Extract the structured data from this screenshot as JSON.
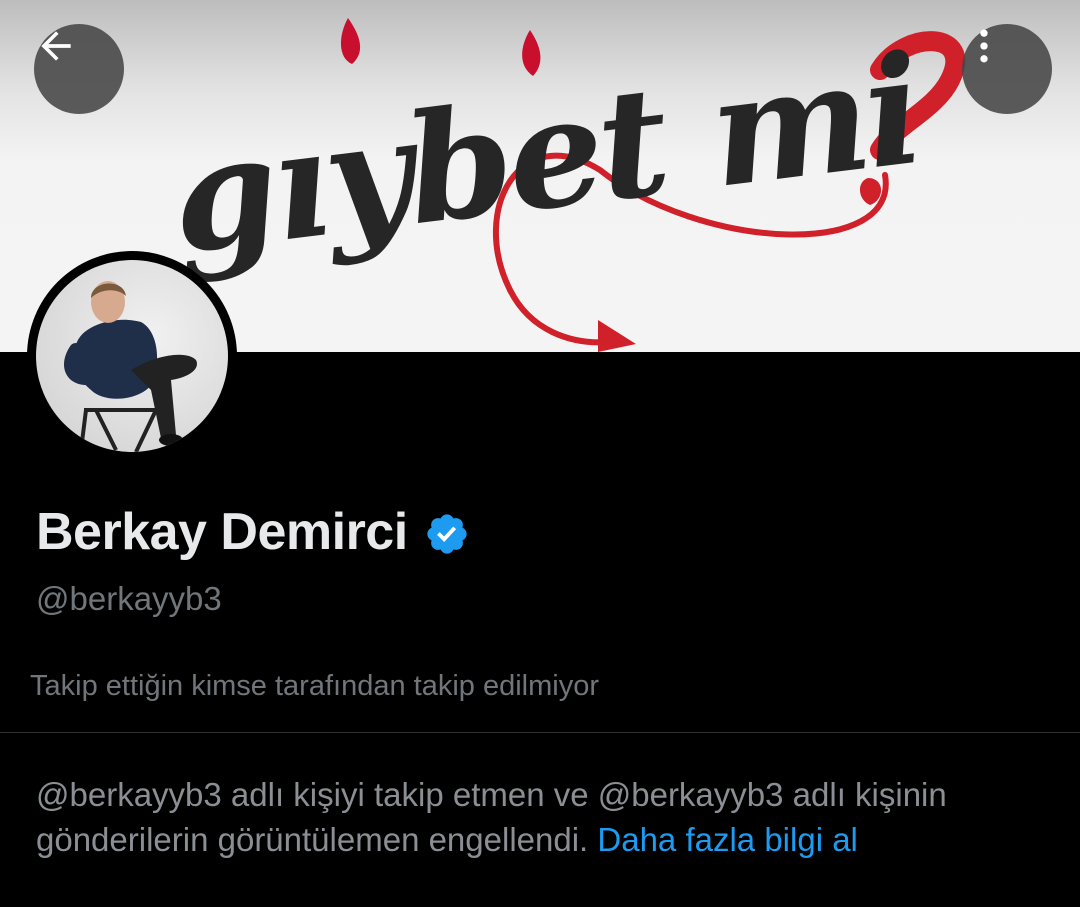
{
  "header": {
    "back_icon": "arrow-left-icon",
    "more_icon": "more-vertical-icon",
    "banner_text": "gıybet mi"
  },
  "profile": {
    "display_name": "Berkay Demirci",
    "verified_icon": "verified-badge-icon",
    "verified_color": "#1d9bf0",
    "handle": "@berkayyb3",
    "follow_context": "Takip ettiğin kimse tarafından takip edilmiyor"
  },
  "notice": {
    "text": "@berkayyb3 adlı kişiyi takip etmen ve @berkayyb3 adlı kişinin gönderilerin görüntülemen engellendi. ",
    "link_label": "Daha fazla bilgi al",
    "link_color": "#1d9bf0"
  }
}
